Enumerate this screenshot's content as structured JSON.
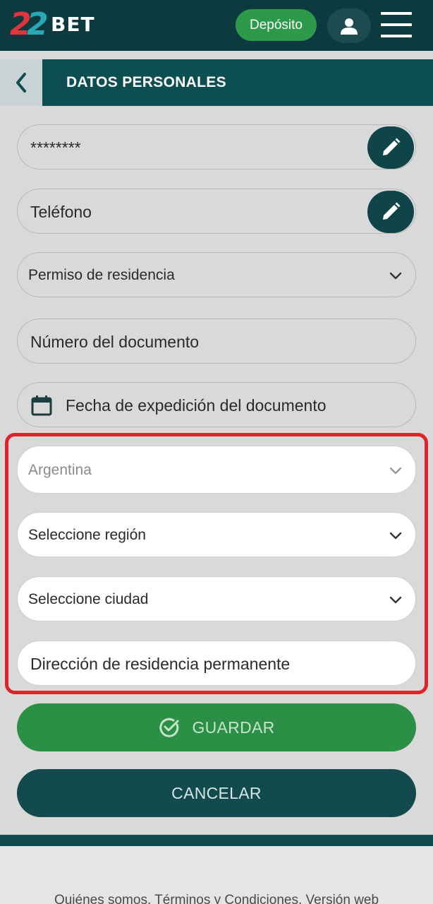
{
  "header": {
    "logo_digits": [
      "2",
      "2"
    ],
    "logo_text": "BET",
    "deposit_label": "Depósito"
  },
  "titlebar": {
    "title": "DATOS PERSONALES"
  },
  "form": {
    "password_value": "********",
    "phone_placeholder": "Teléfono",
    "residence_permit_label": "Permiso de residencia",
    "document_number_placeholder": "Número del documento",
    "document_date_placeholder": "Fecha de expedición del documento",
    "country_value": "Argentina",
    "region_label": "Seleccione región",
    "city_label": "Seleccione ciudad",
    "address_placeholder": "Dirección de residencia permanente"
  },
  "actions": {
    "save_label": "GUARDAR",
    "cancel_label": "CANCELAR"
  },
  "footer": {
    "links": [
      "Quiénes somos",
      "Términos y Condiciones",
      "Versión web"
    ]
  },
  "colors": {
    "header_bg": "#0d3a3e",
    "titlebar_bg": "#0d4e52",
    "accent_green": "#2c9a4a",
    "highlight_red": "#e0232a"
  }
}
